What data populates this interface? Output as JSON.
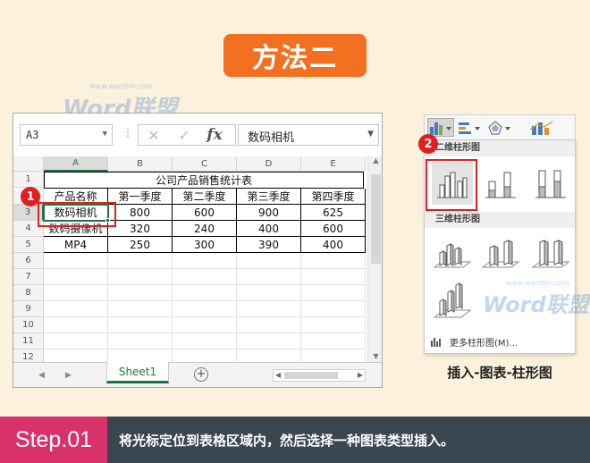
{
  "header": {
    "title": "方法二"
  },
  "watermarks": {
    "main": "Word联盟",
    "url": "www.wordlm.com"
  },
  "formula_bar": {
    "name_box": "A3",
    "dots": "⋮",
    "cancel": "✕",
    "enter": "✓",
    "fx": "fx",
    "content": "数码相机"
  },
  "columns": [
    "A",
    "B",
    "C",
    "D",
    "E"
  ],
  "rows": [
    "1",
    "2",
    "3",
    "4",
    "5",
    "6",
    "7",
    "8",
    "9",
    "10",
    "11",
    "12"
  ],
  "table": {
    "title": "公司产品销售统计表",
    "headers": [
      "产品名称",
      "第一季度",
      "第二季度",
      "第三季度",
      "第四季度"
    ],
    "data": [
      [
        "数码相机",
        "800",
        "600",
        "900",
        "625"
      ],
      [
        "数码摄像机",
        "320",
        "240",
        "400",
        "600"
      ],
      [
        "MP4",
        "250",
        "300",
        "390",
        "400"
      ]
    ]
  },
  "sheet": {
    "tab": "Sheet1",
    "add": "+"
  },
  "markers": {
    "one": "1",
    "two": "2"
  },
  "chart_menu": {
    "section_2d": "二维柱形图",
    "section_3d": "三维柱形图",
    "more": "更多柱形图(M)..."
  },
  "caption": "插入-图表-柱形图",
  "step": {
    "label": "Step.01",
    "text": "将光标定位到表格区域内，然后选择一种图表类型插入。"
  }
}
